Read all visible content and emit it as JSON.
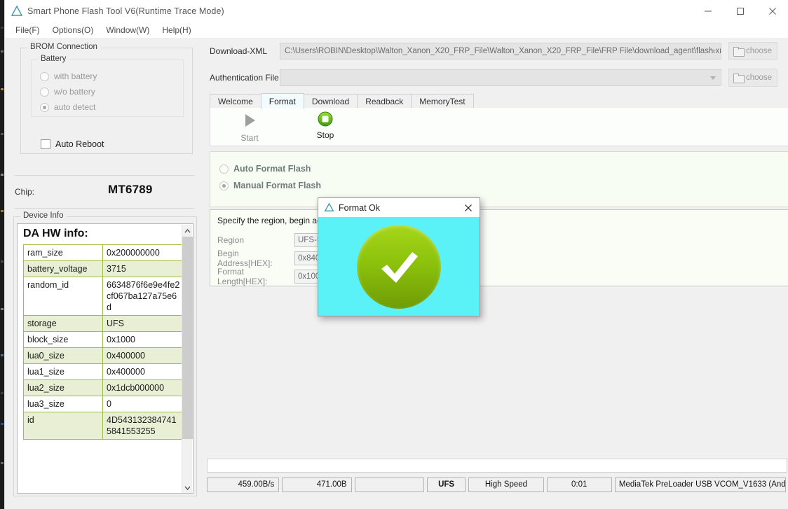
{
  "window": {
    "title": "Smart Phone Flash Tool V6(Runtime Trace Mode)",
    "logo_icon": "triangle-logo-icon",
    "minimize_icon": "minimize-icon",
    "maximize_icon": "maximize-icon",
    "close_icon": "close-icon"
  },
  "menu": {
    "items": [
      {
        "label": "File(F)"
      },
      {
        "label": "Options(O)"
      },
      {
        "label": "Window(W)"
      },
      {
        "label": "Help(H)"
      }
    ]
  },
  "left": {
    "brom": {
      "group_title": "BROM Connection",
      "battery_group_title": "Battery",
      "options": [
        {
          "label": "with battery",
          "checked": false
        },
        {
          "label": "w/o battery",
          "checked": false
        },
        {
          "label": "auto detect",
          "checked": true
        }
      ],
      "auto_reboot_label": "Auto Reboot",
      "auto_reboot_checked": false
    },
    "chip": {
      "label": "Chip:",
      "value": "MT6789"
    },
    "device_info": {
      "group_title": "Device Info",
      "heading": "DA HW info:",
      "rows": [
        {
          "key": "ram_size",
          "value": "0x200000000"
        },
        {
          "key": "battery_voltage",
          "value": "3715"
        },
        {
          "key": "random_id",
          "value": "6634876f6e9e4fe2cf067ba127a75e6d"
        },
        {
          "key": "storage",
          "value": "UFS"
        },
        {
          "key": "block_size",
          "value": "0x1000"
        },
        {
          "key": "lua0_size",
          "value": "0x400000"
        },
        {
          "key": "lua1_size",
          "value": "0x400000"
        },
        {
          "key": "lua2_size",
          "value": "0x1dcb000000"
        },
        {
          "key": "lua3_size",
          "value": "0"
        },
        {
          "key": "id",
          "value": "4D5431323847415841553255"
        }
      ],
      "scroll_up_icon": "chevron-up-icon",
      "scroll_down_icon": "chevron-down-icon"
    }
  },
  "right": {
    "download_xml": {
      "label": "Download-XML",
      "value": "C:\\Users\\ROBIN\\Desktop\\Walton_Xanon_X20_FRP_File\\Walton_Xanon_X20_FRP_File\\FRP File\\download_agent\\flash.xml",
      "choose_label": "choose"
    },
    "auth_file": {
      "label": "Authentication File",
      "value": "",
      "choose_label": "choose"
    },
    "tabs": [
      {
        "label": "Welcome",
        "active": false
      },
      {
        "label": "Format",
        "active": true
      },
      {
        "label": "Download",
        "active": false
      },
      {
        "label": "Readback",
        "active": false
      },
      {
        "label": "MemoryTest",
        "active": false
      }
    ],
    "toolbar": {
      "start_label": "Start",
      "start_icon": "play-triangle-icon",
      "stop_label": "Stop",
      "stop_icon": "stop-square-icon"
    },
    "format_options": [
      {
        "label": "Auto Format Flash",
        "checked": false
      },
      {
        "label": "Manual Format Flash",
        "checked": true
      }
    ],
    "region": {
      "hint": "Specify the region, begin address and format length",
      "fields": [
        {
          "label": "Region",
          "value": "UFS-LU"
        },
        {
          "label": "Begin Address[HEX]:",
          "value": "0x840"
        },
        {
          "label": "Format Length[HEX]:",
          "value": "0x100"
        }
      ]
    }
  },
  "status_bar": {
    "speed": "459.00B/s",
    "bytes": "471.00B",
    "blank": "",
    "storage": "UFS",
    "usb_speed": "High Speed",
    "elapsed": "0:01",
    "port": "MediaTek PreLoader USB VCOM_V1633 (And"
  },
  "dialog": {
    "title": "Format Ok",
    "logo_icon": "triangle-logo-icon",
    "close_icon": "close-icon",
    "status_icon": "green-check-circle-icon",
    "background_color": "#5af2f7",
    "circle_color": "#8ec40d"
  }
}
